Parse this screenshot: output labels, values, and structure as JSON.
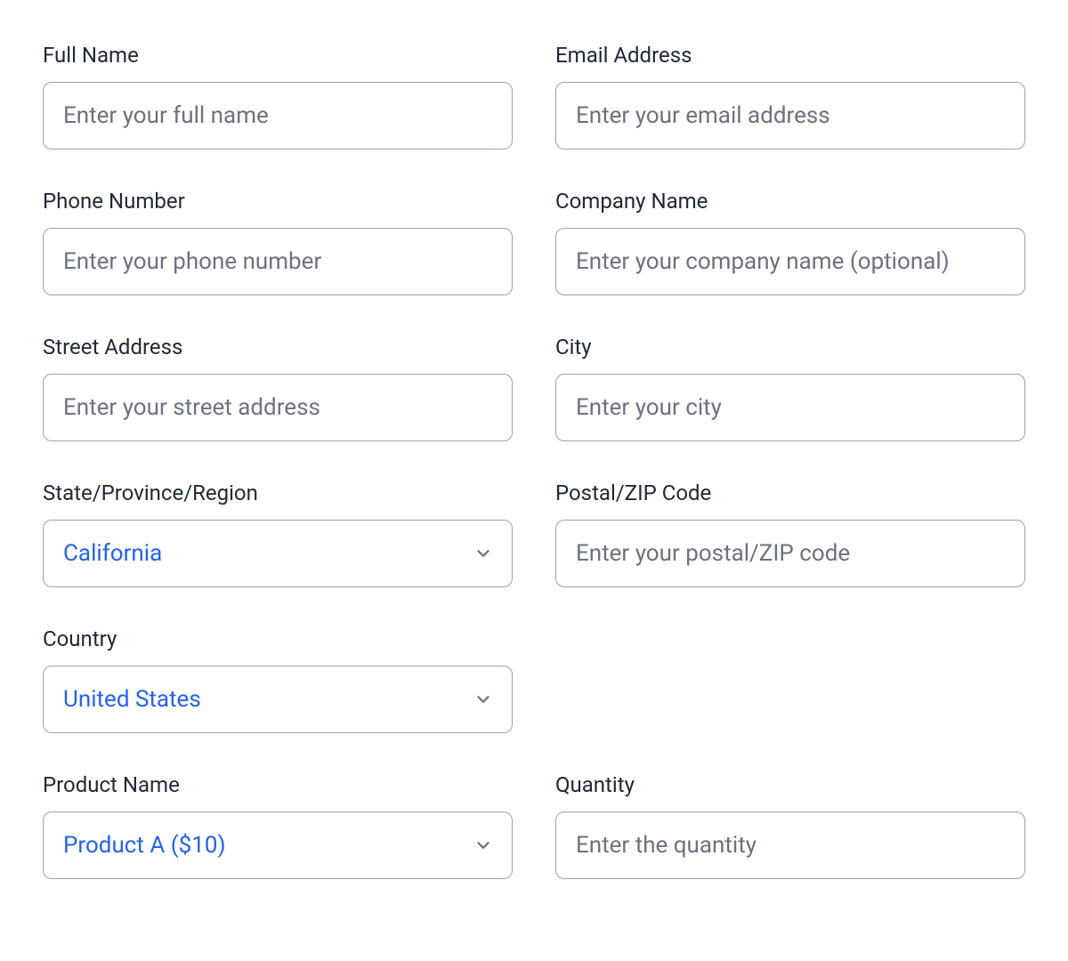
{
  "fields": {
    "full_name": {
      "label": "Full Name",
      "placeholder": "Enter your full name",
      "value": ""
    },
    "email": {
      "label": "Email Address",
      "placeholder": "Enter your email address",
      "value": ""
    },
    "phone": {
      "label": "Phone Number",
      "placeholder": "Enter your phone number",
      "value": ""
    },
    "company": {
      "label": "Company Name",
      "placeholder": "Enter your company name (optional)",
      "value": ""
    },
    "street": {
      "label": "Street Address",
      "placeholder": "Enter your street address",
      "value": ""
    },
    "city": {
      "label": "City",
      "placeholder": "Enter your city",
      "value": ""
    },
    "state": {
      "label": "State/Province/Region",
      "selected": "California"
    },
    "postal": {
      "label": "Postal/ZIP Code",
      "placeholder": "Enter your postal/ZIP code",
      "value": ""
    },
    "country": {
      "label": "Country",
      "selected": "United States"
    },
    "product": {
      "label": "Product Name",
      "selected": "Product A ($10)"
    },
    "quantity": {
      "label": "Quantity",
      "placeholder": "Enter the quantity",
      "value": ""
    }
  }
}
